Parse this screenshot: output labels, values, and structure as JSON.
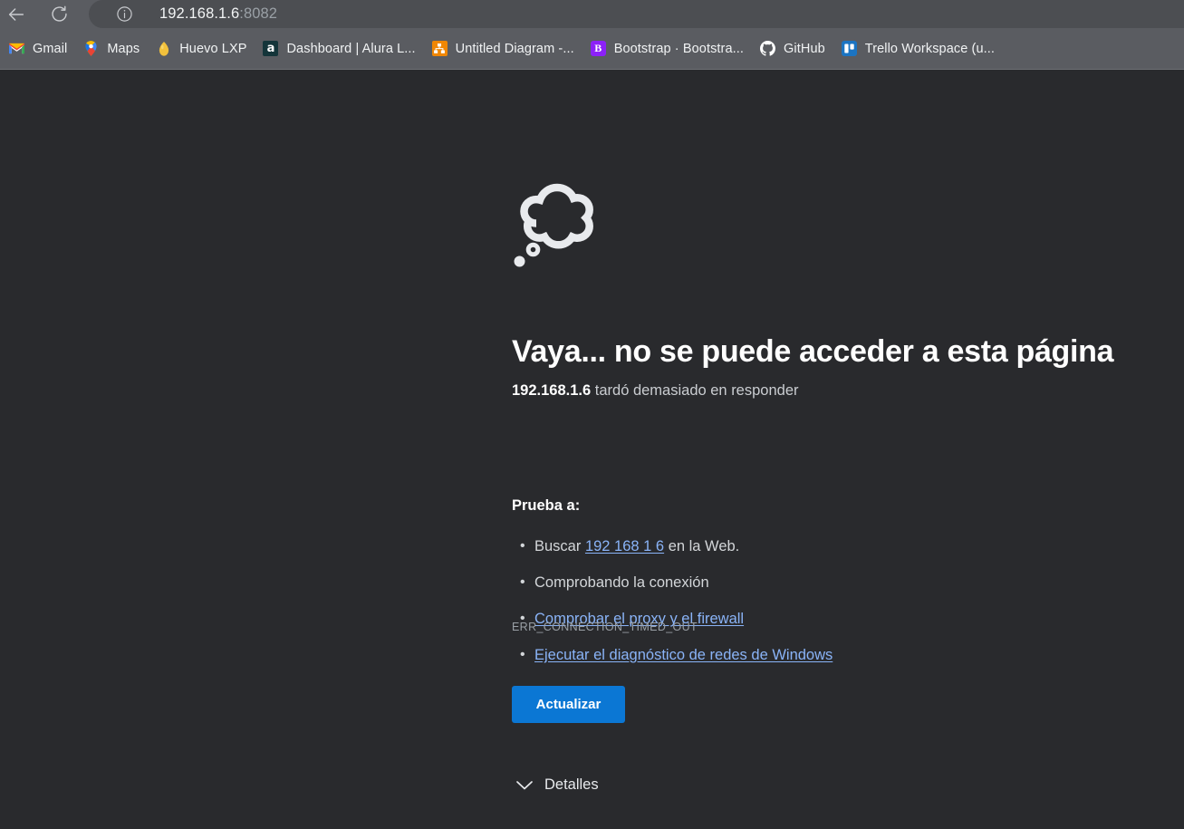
{
  "browser": {
    "back_icon": "back-arrow-icon",
    "reload_icon": "reload-icon",
    "omnibox": {
      "info_icon": "info-circle-icon",
      "url_host": "192.168.1.6",
      "url_rest": ":8082",
      "full_url": "192.168.1.6:8082"
    },
    "bookmarks": [
      {
        "label": "Gmail",
        "icon": "gmail-icon"
      },
      {
        "label": "Maps",
        "icon": "google-maps-icon"
      },
      {
        "label": "Huevo LXP",
        "icon": "egg-icon"
      },
      {
        "label": "Dashboard | Alura L...",
        "icon": "alura-icon",
        "icon_text": "a"
      },
      {
        "label": "Untitled Diagram -...",
        "icon": "drawio-icon"
      },
      {
        "label": "Bootstrap · Bootstra...",
        "icon": "bootstrap-icon",
        "icon_text": "B"
      },
      {
        "label": "GitHub",
        "icon": "github-icon"
      },
      {
        "label": "Trello Workspace (u...",
        "icon": "trello-icon"
      }
    ]
  },
  "error_page": {
    "illustration": "cloud-thought-bubble-icon",
    "title": "Vaya... no se puede acceder a esta página",
    "subtitle_host": "192.168.1.6",
    "subtitle_rest": " tardó demasiado en responder",
    "suggestions_heading": "Prueba a:",
    "suggestions": [
      {
        "prefix": "Buscar ",
        "link": "192 168 1 6",
        "suffix": " en la Web."
      },
      {
        "prefix": "Comprobando la conexión",
        "link": "",
        "suffix": ""
      },
      {
        "prefix": "",
        "link": "Comprobar el proxy y el firewall",
        "suffix": ""
      },
      {
        "prefix": "",
        "link": "Ejecutar el diagnóstico de redes de Windows",
        "suffix": ""
      }
    ],
    "error_code": "ERR_CONNECTION_TIMED_OUT",
    "reload_button": "Actualizar",
    "details_label": "Detalles",
    "details_icon": "chevron-down-icon"
  },
  "colors": {
    "chrome_toolbar": "#5a5c61",
    "omnibox": "#4c4e52",
    "page_background": "#292a2d",
    "accent_button": "#0b77d4",
    "link": "#8ab4f8",
    "error_code_text": "#9aa0a6"
  }
}
